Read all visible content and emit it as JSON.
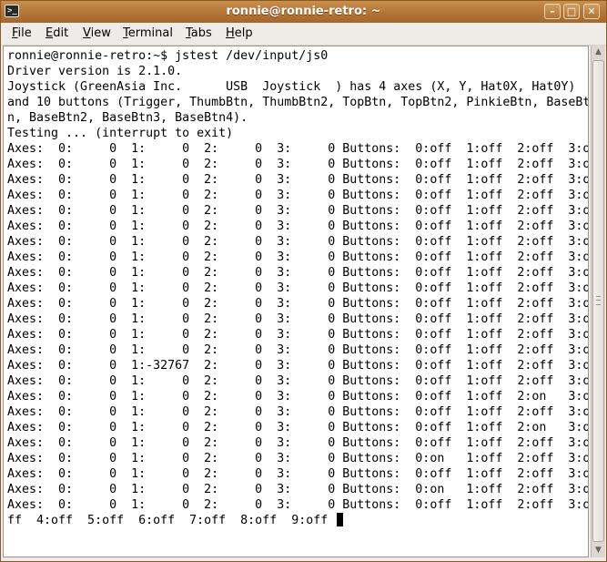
{
  "window": {
    "title": "ronnie@ronnie-retro: ~",
    "app_icon_glyph": ">_",
    "minimize_glyph": "–",
    "maximize_glyph": "□",
    "close_glyph": "✕"
  },
  "menubar": {
    "items": [
      {
        "mnemonic": "F",
        "rest": "ile"
      },
      {
        "mnemonic": "E",
        "rest": "dit"
      },
      {
        "mnemonic": "V",
        "rest": "iew"
      },
      {
        "mnemonic": "T",
        "rest": "erminal"
      },
      {
        "mnemonic": "T",
        "rest": "abs"
      },
      {
        "mnemonic": "H",
        "rest": "elp"
      }
    ]
  },
  "terminal": {
    "lines": [
      "ronnie@ronnie-retro:~$ jstest /dev/input/js0",
      "Driver version is 2.1.0.",
      "Joystick (GreenAsia Inc.      USB  Joystick  ) has 4 axes (X, Y, Hat0X, Hat0Y)",
      "and 10 buttons (Trigger, ThumbBtn, ThumbBtn2, TopBtn, TopBtn2, PinkieBtn, BaseBt",
      "n, BaseBtn2, BaseBtn3, BaseBtn4).",
      "Testing ... (interrupt to exit)",
      "Axes:  0:     0  1:     0  2:     0  3:     0 Buttons:  0:off  1:off  2:off  3:o",
      "Axes:  0:     0  1:     0  2:     0  3:     0 Buttons:  0:off  1:off  2:off  3:o",
      "Axes:  0:     0  1:     0  2:     0  3:     0 Buttons:  0:off  1:off  2:off  3:o",
      "Axes:  0:     0  1:     0  2:     0  3:     0 Buttons:  0:off  1:off  2:off  3:o",
      "Axes:  0:     0  1:     0  2:     0  3:     0 Buttons:  0:off  1:off  2:off  3:o",
      "Axes:  0:     0  1:     0  2:     0  3:     0 Buttons:  0:off  1:off  2:off  3:o",
      "Axes:  0:     0  1:     0  2:     0  3:     0 Buttons:  0:off  1:off  2:off  3:o",
      "Axes:  0:     0  1:     0  2:     0  3:     0 Buttons:  0:off  1:off  2:off  3:o",
      "Axes:  0:     0  1:     0  2:     0  3:     0 Buttons:  0:off  1:off  2:off  3:o",
      "Axes:  0:     0  1:     0  2:     0  3:     0 Buttons:  0:off  1:off  2:off  3:o",
      "Axes:  0:     0  1:     0  2:     0  3:     0 Buttons:  0:off  1:off  2:off  3:o",
      "Axes:  0:     0  1:     0  2:     0  3:     0 Buttons:  0:off  1:off  2:off  3:o",
      "Axes:  0:     0  1:     0  2:     0  3:     0 Buttons:  0:off  1:off  2:off  3:o",
      "Axes:  0:     0  1:     0  2:     0  3:     0 Buttons:  0:off  1:off  2:off  3:o",
      "Axes:  0:     0  1:-32767  2:     0  3:     0 Buttons:  0:off  1:off  2:off  3:o",
      "Axes:  0:     0  1:     0  2:     0  3:     0 Buttons:  0:off  1:off  2:off  3:o",
      "Axes:  0:     0  1:     0  2:     0  3:     0 Buttons:  0:off  1:off  2:on   3:o",
      "Axes:  0:     0  1:     0  2:     0  3:     0 Buttons:  0:off  1:off  2:off  3:o",
      "Axes:  0:     0  1:     0  2:     0  3:     0 Buttons:  0:off  1:off  2:on   3:o",
      "Axes:  0:     0  1:     0  2:     0  3:     0 Buttons:  0:off  1:off  2:off  3:o",
      "Axes:  0:     0  1:     0  2:     0  3:     0 Buttons:  0:on   1:off  2:off  3:o",
      "Axes:  0:     0  1:     0  2:     0  3:     0 Buttons:  0:off  1:off  2:off  3:o",
      "Axes:  0:     0  1:     0  2:     0  3:     0 Buttons:  0:on   1:off  2:off  3:o",
      "Axes:  0:     0  1:     0  2:     0  3:     0 Buttons:  0:off  1:off  2:off  3:o",
      "ff  4:off  5:off  6:off  7:off  8:off  9:off "
    ]
  }
}
